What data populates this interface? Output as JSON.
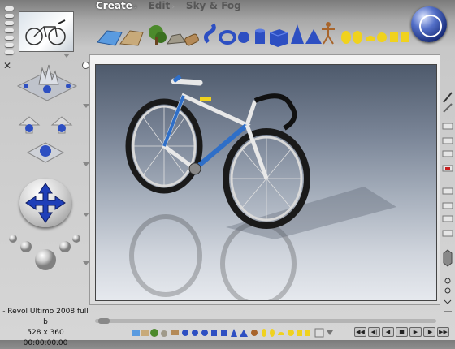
{
  "menu": {
    "items": [
      {
        "label": "Create",
        "active": true
      },
      {
        "label": "Edit",
        "active": false
      },
      {
        "label": "Sky & Fog",
        "active": false
      }
    ],
    "arrow_glyph": "›"
  },
  "palette": {
    "items": [
      "water-icon",
      "terrain-icon",
      "tree-icon",
      "rock-icon",
      "wood-icon",
      "twist-icon",
      "torus-icon",
      "sphere-icon",
      "cylinder-icon",
      "cube-icon",
      "cone-icon",
      "pyramid-icon",
      "figure-icon",
      "ellipsoid-icon",
      "half-sphere-icon",
      "box-icon"
    ]
  },
  "scene": {
    "document_title": "- Revol Ultimo 2008 full b",
    "resolution": "528 x 360",
    "timecode": "00:00:00.00"
  },
  "vcr": {
    "buttons": [
      "◀◀",
      "◀|",
      "◀",
      "■",
      "▶",
      "|▶",
      "▶▶"
    ]
  },
  "colors": {
    "accent": "#2d4fc2",
    "menu_active": "#ffffff",
    "menu_inactive": "#575757",
    "frame_tube": "#e8e8e8",
    "frame_blue": "#2f6fc8",
    "frame_yellow": "#f0d21e"
  }
}
